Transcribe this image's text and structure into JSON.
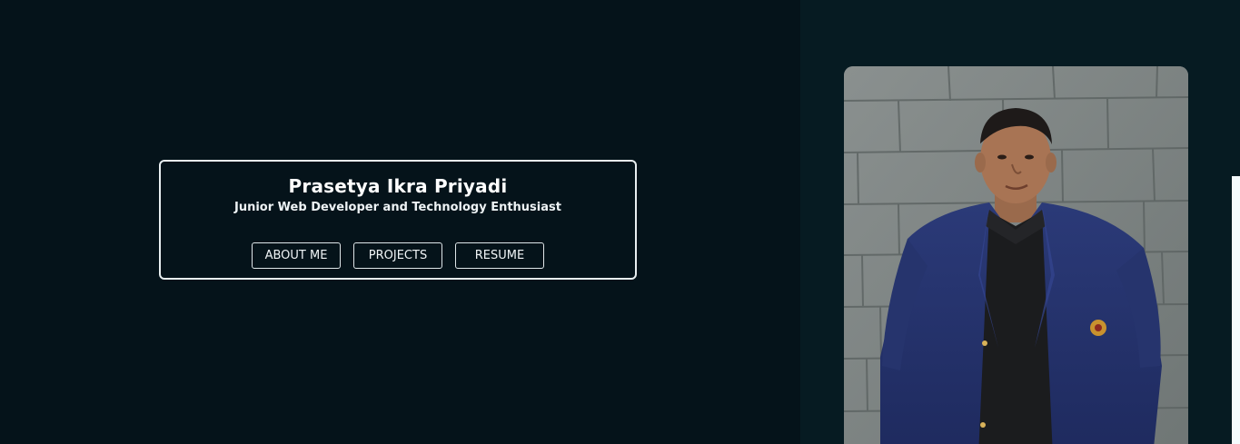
{
  "intro": {
    "name": "Prasetya Ikra Priyadi",
    "tagline": "Junior Web Developer and Technology Enthusiast"
  },
  "nav_buttons": [
    {
      "label": "ABOUT ME"
    },
    {
      "label": "PROJECTS"
    },
    {
      "label": "RESUME"
    }
  ],
  "photo": {
    "subject": "portrait of a young man in a navy blazer standing in front of a grey stone wall"
  },
  "colors": {
    "left_background": "#05131a",
    "right_background": "#061b22",
    "card_border": "#e8eef0",
    "text": "#ffffff"
  }
}
